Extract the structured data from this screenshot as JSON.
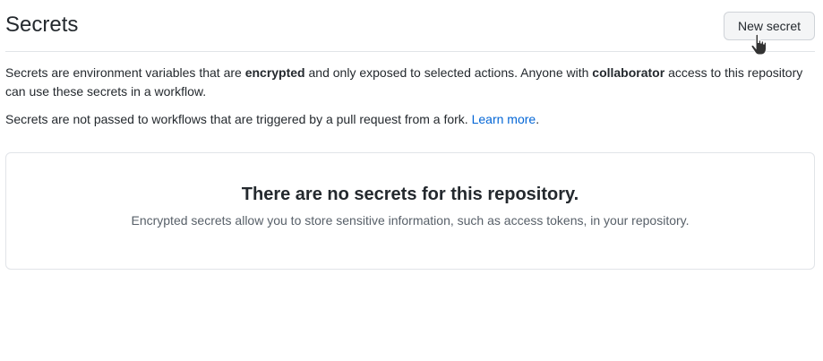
{
  "header": {
    "title": "Secrets",
    "new_secret_label": "New secret"
  },
  "description": {
    "p1_part1": "Secrets are environment variables that are ",
    "p1_bold1": "encrypted",
    "p1_part2": " and only exposed to selected actions. Anyone with ",
    "p1_bold2": "collaborator",
    "p1_part3": " access to this repository can use these secrets in a workflow.",
    "p2_text": "Secrets are not passed to workflows that are triggered by a pull request from a fork. ",
    "p2_link": "Learn more",
    "p2_end": "."
  },
  "empty_state": {
    "title": "There are no secrets for this repository.",
    "text": "Encrypted secrets allow you to store sensitive information, such as access tokens, in your repository."
  },
  "icons": {
    "cursor": "hand-pointer-icon"
  }
}
